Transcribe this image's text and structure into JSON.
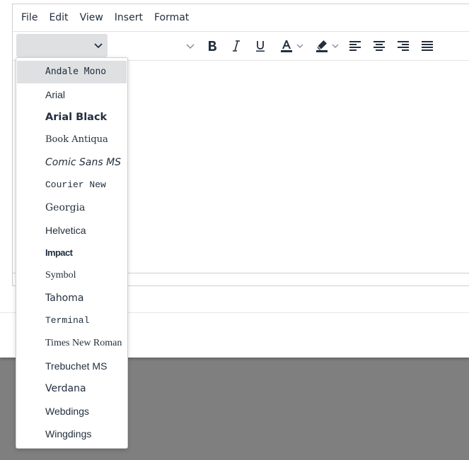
{
  "menubar": {
    "items": [
      "File",
      "Edit",
      "View",
      "Insert",
      "Format"
    ]
  },
  "toolbar": {
    "font_family_value": "",
    "buttons": [
      {
        "name": "font-size-chevron-icon"
      },
      {
        "name": "bold-icon"
      },
      {
        "name": "italic-icon"
      },
      {
        "name": "underline-icon"
      },
      {
        "name": "text-color-icon",
        "color": "#222f3e"
      },
      {
        "name": "highlight-color-icon",
        "color": "#222f3e"
      },
      {
        "name": "align-left-icon"
      },
      {
        "name": "align-center-icon"
      },
      {
        "name": "align-right-icon"
      },
      {
        "name": "align-justify-icon"
      }
    ]
  },
  "font_dropdown": {
    "active_index": 0,
    "items": [
      {
        "label": "Andale Mono"
      },
      {
        "label": "Arial"
      },
      {
        "label": "Arial Black"
      },
      {
        "label": "Book Antiqua"
      },
      {
        "label": "Comic Sans MS"
      },
      {
        "label": "Courier New"
      },
      {
        "label": "Georgia"
      },
      {
        "label": "Helvetica"
      },
      {
        "label": "Impact"
      },
      {
        "label": "Symbol"
      },
      {
        "label": "Tahoma"
      },
      {
        "label": "Terminal"
      },
      {
        "label": "Times New Roman"
      },
      {
        "label": "Trebuchet MS"
      },
      {
        "label": "Verdana"
      },
      {
        "label": "Webdings"
      },
      {
        "label": "Wingdings"
      }
    ]
  },
  "colors": {
    "text": "#222f3e",
    "active_item_bg": "#dee0e2",
    "backdrop": "#7f7f7f"
  }
}
